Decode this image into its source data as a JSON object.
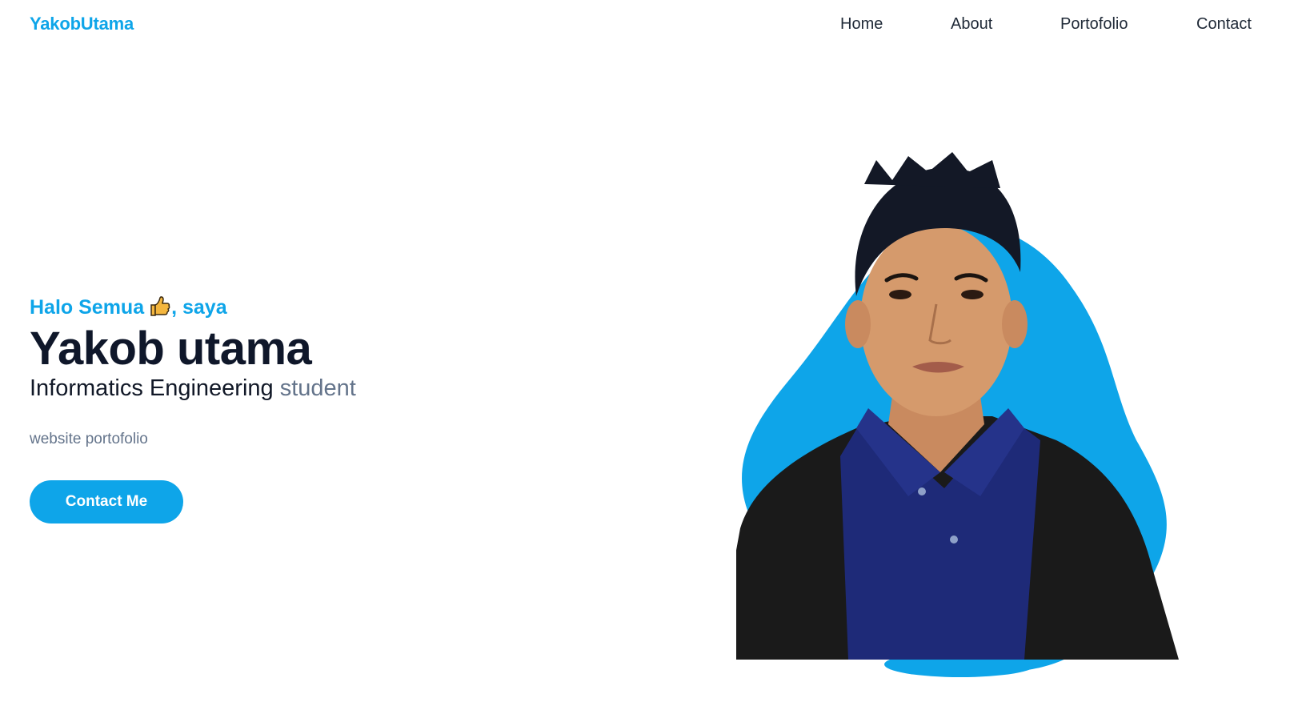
{
  "navbar": {
    "brand": "YakobUtama",
    "links": [
      {
        "label": "Home"
      },
      {
        "label": "About"
      },
      {
        "label": "Portofolio"
      },
      {
        "label": "Contact"
      }
    ]
  },
  "hero": {
    "greeting_prefix": "Halo Semua",
    "greeting_icon": "thumbs-up-icon",
    "greeting_suffix": ", saya",
    "name": "Yakob utama",
    "role_main": "Informatics Engineering",
    "role_accent": "student",
    "tagline": "website portofolio",
    "cta_label": "Contact Me",
    "photo_subject": "profile-photo"
  },
  "colors": {
    "accent": "#0ea5e9",
    "heading": "#0f172a",
    "muted": "#64748b",
    "background": "#ffffff"
  }
}
